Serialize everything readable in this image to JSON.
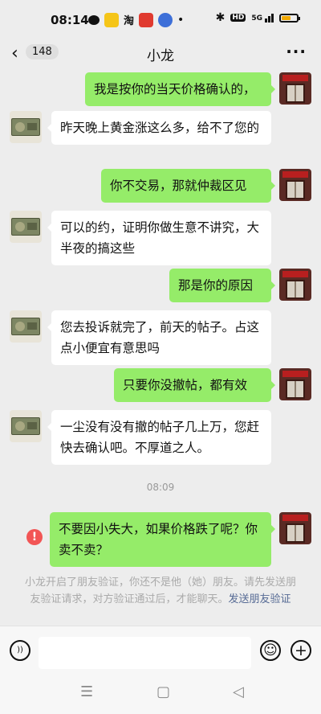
{
  "status_bar": {
    "time": "08:14",
    "apps": [
      "wechat-icon",
      "treasure-app-icon",
      "taobao-icon",
      "red-app-icon",
      "blue-app-icon"
    ],
    "apps_text": [
      "淘"
    ],
    "dot": "•",
    "signal_text": "5G",
    "hd_text": "HD",
    "battery_level": 0.55,
    "battery_color": "#f0a800"
  },
  "nav": {
    "back_glyph": "‹",
    "unread_count": "148",
    "title": "小龙",
    "more_glyph": "···"
  },
  "messages": [
    {
      "side": "right",
      "text": "我是按你的当天价格确认的，"
    },
    {
      "side": "left",
      "text": "昨天晚上黄金涨这么多，给不了您的"
    },
    {
      "side": "right",
      "text": "你不交易，那就仲裁区见"
    },
    {
      "side": "left",
      "text": "可以的约，证明你做生意不讲究，大半夜的搞这些"
    },
    {
      "side": "right",
      "text": "那是你的原因"
    },
    {
      "side": "left",
      "text": "您去投诉就完了，前天的帖子。占这点小便宜有意思吗"
    },
    {
      "side": "right",
      "text": "只要你没撤帖，都有效"
    },
    {
      "side": "left",
      "text": "一尘没有没有撤的帖子几上万，您赶快去确认吧。不厚道之人。"
    },
    {
      "side": "right",
      "text": "不要因小失大，如果价格跌了呢？你卖不卖？",
      "failed": true
    }
  ],
  "timestamp": "08:09",
  "error_glyph": "!",
  "system_message": {
    "text": "小龙开启了朋友验证，你还不是他（她）朋友。请先发送朋友验证请求，对方验证通过后，才能聊天。",
    "link": "发送朋友验证"
  },
  "input_bar": {
    "voice_glyph": "))",
    "emoji_glyph": "☺",
    "plus_glyph": "+"
  },
  "system_nav": {
    "menu_glyph": "☰",
    "home_glyph": "▢",
    "back_glyph": "◁"
  },
  "colors": {
    "sent_bubble": "#95ec69",
    "received_bubble": "#ffffff",
    "background": "#ededed",
    "error": "#f25555",
    "link": "#576b95"
  }
}
